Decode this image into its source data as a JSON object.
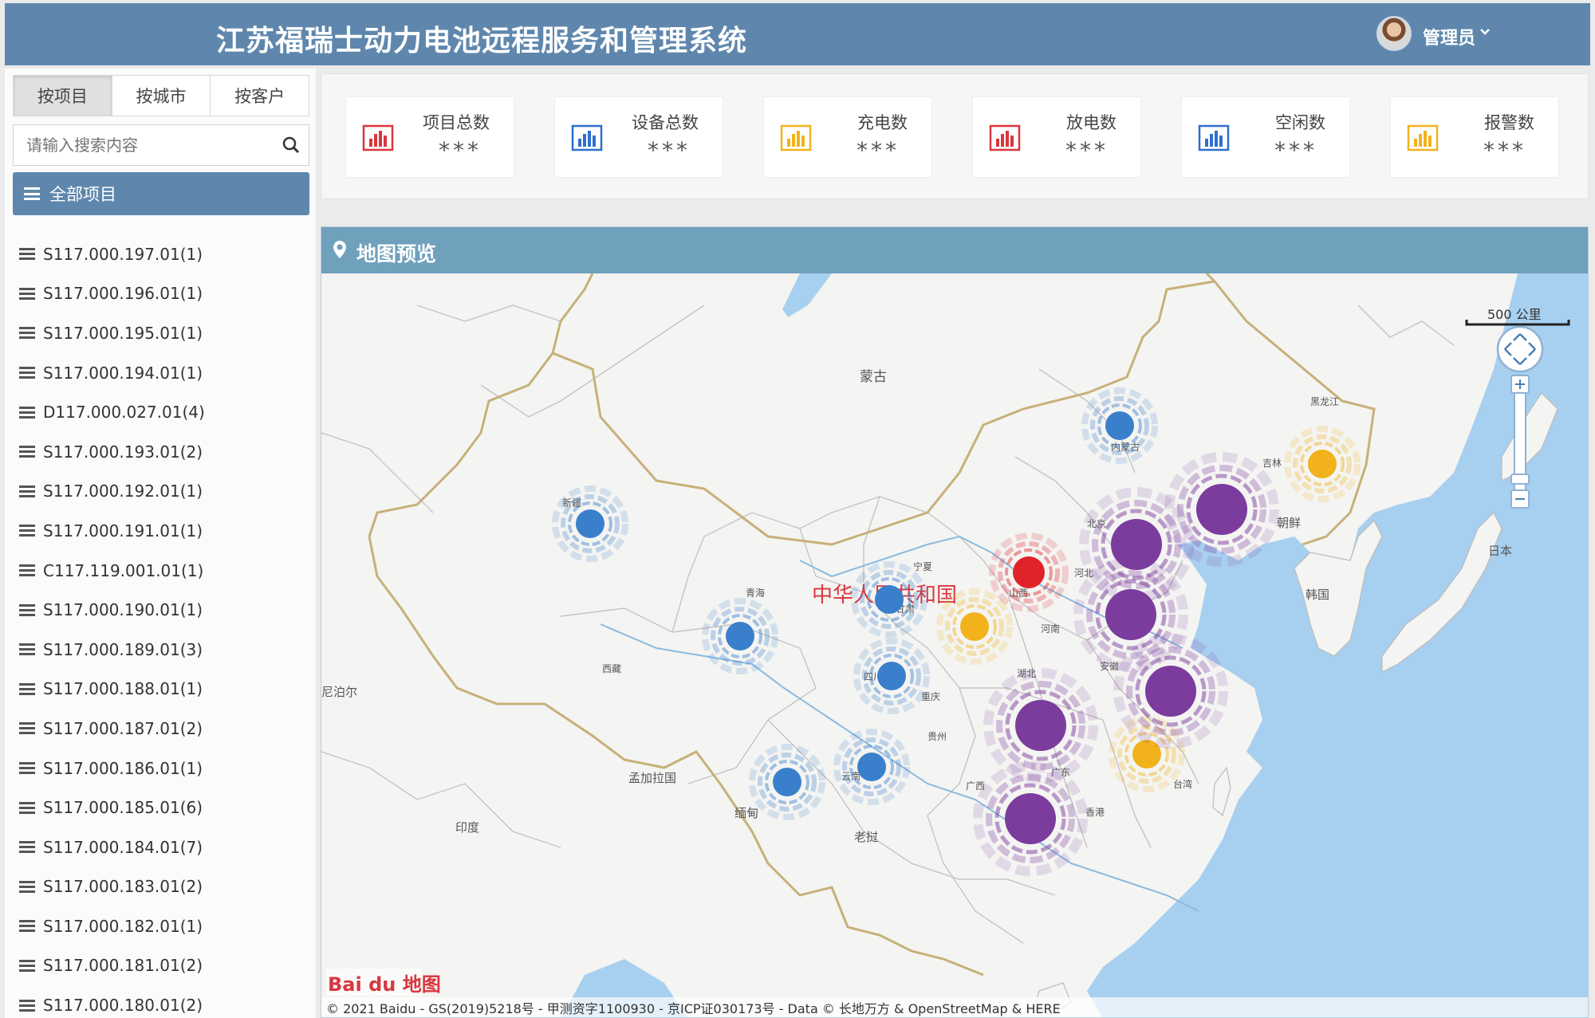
{
  "header": {
    "title": "江苏福瑞士动力电池远程服务和管理系统",
    "user": "管理员"
  },
  "sidebar": {
    "tabs": [
      "按项目",
      "按城市",
      "按客户"
    ],
    "search_placeholder": "请输入搜索内容",
    "all_label": "全部项目",
    "projects": [
      "S117.000.197.01(1)",
      "S117.000.196.01(1)",
      "S117.000.195.01(1)",
      "S117.000.194.01(1)",
      "D117.000.027.01(4)",
      "S117.000.193.01(2)",
      "S117.000.192.01(1)",
      "S117.000.191.01(1)",
      "C117.119.001.01(1)",
      "S117.000.190.01(1)",
      "S117.000.189.01(3)",
      "S117.000.188.01(1)",
      "S117.000.187.01(2)",
      "S117.000.186.01(1)",
      "S117.000.185.01(6)",
      "S117.000.184.01(7)",
      "S117.000.183.01(2)",
      "S117.000.182.01(1)",
      "S117.000.181.01(2)",
      "S117.000.180.01(2)"
    ]
  },
  "stats": [
    {
      "label": "项目总数",
      "value": "***",
      "color": "#d9363e",
      "icon": "bar-chart-icon"
    },
    {
      "label": "设备总数",
      "value": "***",
      "color": "#2f6fd0",
      "icon": "bar-chart-icon"
    },
    {
      "label": "充电数",
      "value": "***",
      "color": "#f2b21b",
      "icon": "bar-chart-icon"
    },
    {
      "label": "放电数",
      "value": "***",
      "color": "#d9363e",
      "icon": "bar-chart-icon"
    },
    {
      "label": "空闲数",
      "value": "***",
      "color": "#2f6fd0",
      "icon": "bar-chart-icon"
    },
    {
      "label": "报警数",
      "value": "***",
      "color": "#f2b21b",
      "icon": "bar-chart-icon"
    }
  ],
  "map": {
    "title": "地图预览",
    "scale_label": "500 公里",
    "country_label": "中华人民共和国",
    "attribution": "© 2021 Baidu - GS(2019)5218号 - 甲测资字1100930 - 京ICP证030173号 - Data © 长地万方 & OpenStreetMap & HERE",
    "logo": "Bai du 地图",
    "labels": [
      "蒙古",
      "内蒙古",
      "黑龙江",
      "吉林",
      "新疆",
      "青海",
      "甘肃",
      "宁夏",
      "山西",
      "河北",
      "北京",
      "河南",
      "西藏",
      "四川",
      "重庆",
      "湖北",
      "安徽",
      "贵州",
      "云南",
      "广西",
      "广东",
      "香港",
      "台湾",
      "朝鲜",
      "韩国",
      "日本",
      "孟加拉国",
      "缅甸",
      "印度",
      "老挝",
      "尼泊尔"
    ],
    "colors": {
      "discharge": "#e0232a",
      "idle": "#3a7fcb",
      "charge": "#f2b21b",
      "cluster": "#7b3c9e"
    }
  }
}
